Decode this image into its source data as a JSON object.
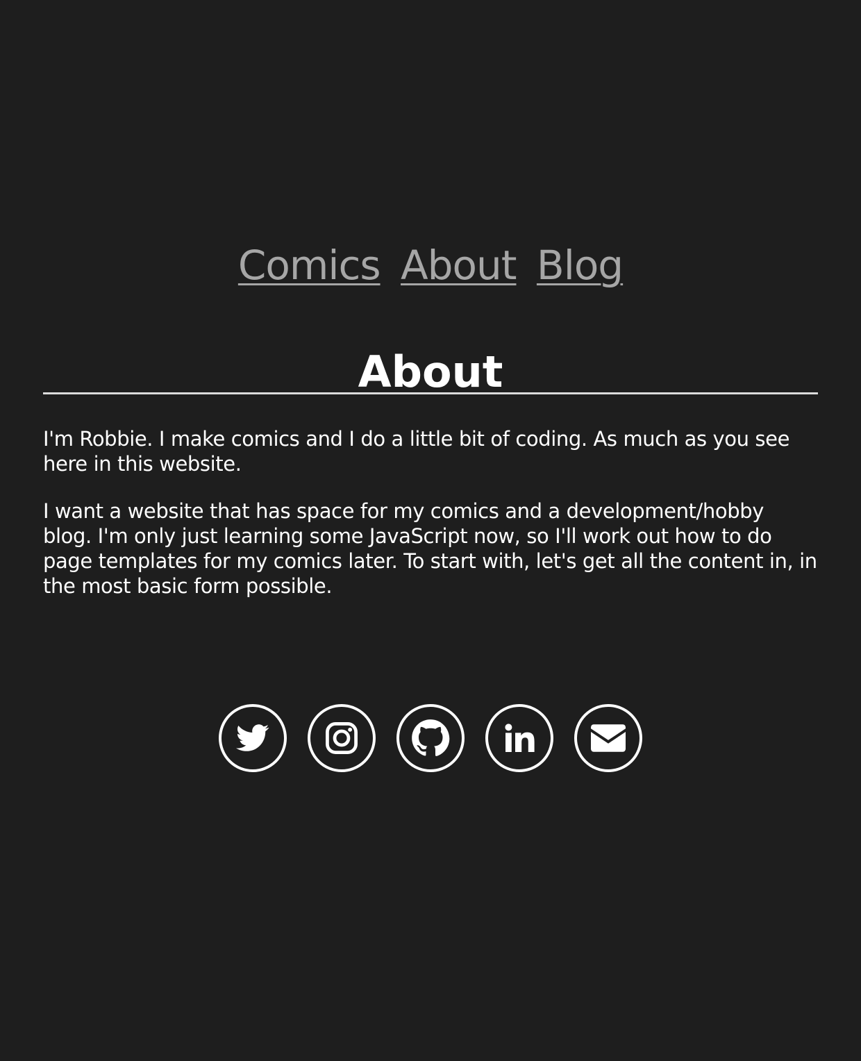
{
  "nav": {
    "comics_label": "Comics",
    "about_label": "About",
    "blog_label": "Blog"
  },
  "page": {
    "title": "About",
    "paragraphs": [
      "I'm Robbie. I make comics and I do a little bit of coding. As much as you see here in this website.",
      "I want a website that has space for my comics and a development/hobby blog. I'm only just learning some JavaScript now, so I'll work out how to do page templates for my comics later. To start with, let's get all the content in, in the most basic form possible."
    ]
  },
  "social": {
    "items": [
      {
        "icon": "twitter-icon"
      },
      {
        "icon": "instagram-icon"
      },
      {
        "icon": "github-icon"
      },
      {
        "icon": "linkedin-icon"
      },
      {
        "icon": "email-icon"
      }
    ]
  },
  "colors": {
    "background": "#1e1e1e",
    "text": "#ffffff",
    "nav_link": "#a6a6a6",
    "rule": "#dcdcdc"
  }
}
